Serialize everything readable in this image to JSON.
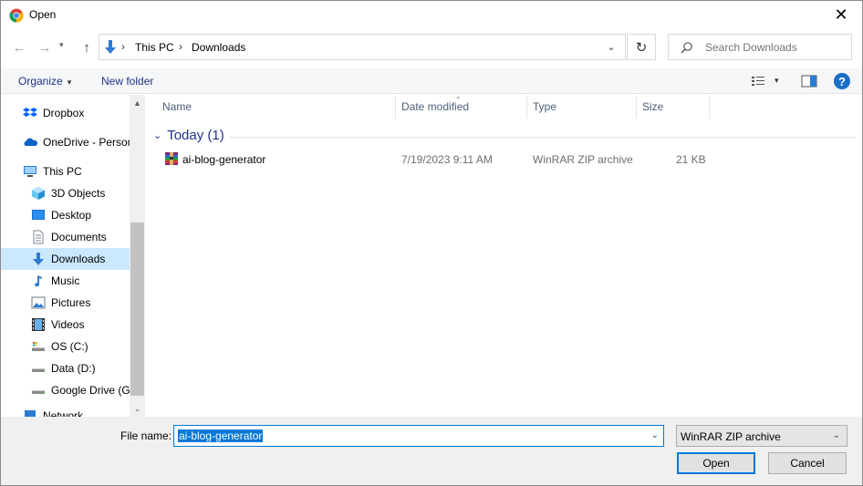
{
  "window": {
    "title": "Open",
    "close_glyph": "✕"
  },
  "nav": {
    "back_glyph": "←",
    "forward_glyph": "→",
    "up_glyph": "↑",
    "breadcrumbs": [
      "This PC",
      "Downloads"
    ],
    "breadcrumb_separator": "›",
    "refresh_glyph": "↻",
    "dropdown_glyph": "⌄"
  },
  "search": {
    "placeholder": "Search Downloads"
  },
  "toolbar": {
    "organize_label": "Organize",
    "caret": "▾",
    "new_folder_label": "New folder",
    "help_label": "?"
  },
  "sidebar": {
    "items": [
      {
        "label": "Dropbox",
        "icon": "dropbox-icon",
        "indent": 0,
        "selected": false
      },
      {
        "label": "OneDrive - Personal",
        "icon": "onedrive-icon",
        "indent": 0,
        "selected": false
      },
      {
        "label": "This PC",
        "icon": "pc-icon",
        "indent": 0,
        "selected": false
      },
      {
        "label": "3D Objects",
        "icon": "cube-icon",
        "indent": 1,
        "selected": false
      },
      {
        "label": "Desktop",
        "icon": "desktop-icon",
        "indent": 1,
        "selected": false
      },
      {
        "label": "Documents",
        "icon": "document-icon",
        "indent": 1,
        "selected": false
      },
      {
        "label": "Downloads",
        "icon": "download-icon",
        "indent": 1,
        "selected": true
      },
      {
        "label": "Music",
        "icon": "music-icon",
        "indent": 1,
        "selected": false
      },
      {
        "label": "Pictures",
        "icon": "pictures-icon",
        "indent": 1,
        "selected": false
      },
      {
        "label": "Videos",
        "icon": "videos-icon",
        "indent": 1,
        "selected": false
      },
      {
        "label": "OS (C:)",
        "icon": "os-drive-icon",
        "indent": 1,
        "selected": false
      },
      {
        "label": "Data (D:)",
        "icon": "drive-icon",
        "indent": 1,
        "selected": false
      },
      {
        "label": "Google Drive (G:)",
        "icon": "drive-icon",
        "indent": 1,
        "selected": false
      },
      {
        "label": "Network",
        "icon": "network-icon",
        "indent": 0,
        "selected": false
      }
    ],
    "scroll_up_glyph": "▲",
    "scroll_down_glyph": "⌄"
  },
  "columns": {
    "name": "Name",
    "date_modified": "Date modified",
    "type": "Type",
    "size": "Size",
    "sort_glyph": "⌄"
  },
  "group": {
    "caret": "⌄",
    "label": "Today (1)"
  },
  "files": [
    {
      "name": "ai-blog-generator",
      "date_modified": "7/19/2023 9:11 AM",
      "type": "WinRAR ZIP archive",
      "size": "21 KB",
      "icon": "winrar-archive-icon"
    }
  ],
  "footer": {
    "file_name_label": "File name:",
    "file_name_value": "ai-blog-generator",
    "file_type_selected": "WinRAR ZIP archive",
    "dropdown_glyph": "⌄",
    "open_label": "Open",
    "cancel_label": "Cancel"
  },
  "colors": {
    "accent": "#0078d7",
    "selection": "#cce8ff",
    "link_text": "#1e3287"
  }
}
